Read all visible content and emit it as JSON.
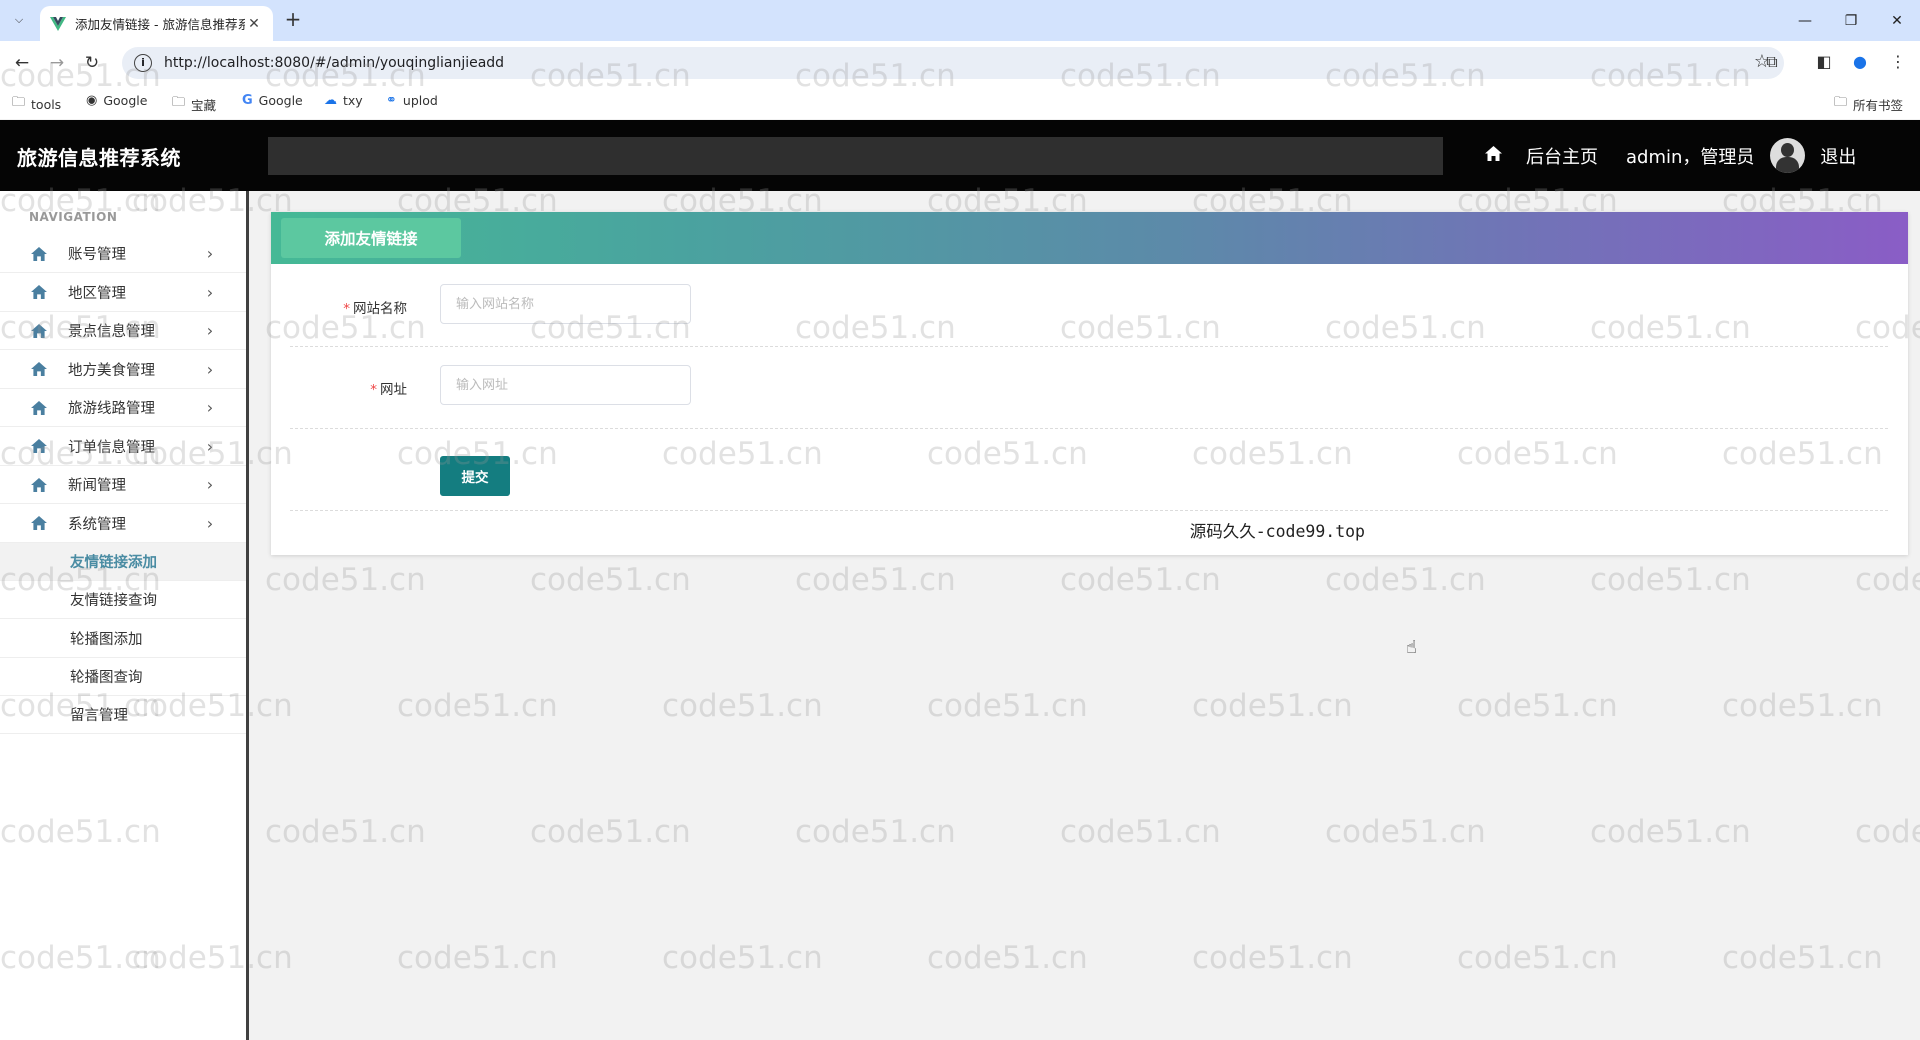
{
  "browser": {
    "tab_title": "添加友情链接 - 旅游信息推荐系",
    "url": "http://localhost:8080/#/admin/youqinglianjieadd",
    "bookmarks": [
      "tools",
      "Google",
      "宝藏",
      "Google",
      "txy",
      "uplod"
    ],
    "all_bookmarks": "所有书签"
  },
  "header": {
    "brand": "旅游信息推荐系统",
    "home_link": "后台主页",
    "user": "admin，管理员",
    "logout": "退出"
  },
  "sidebar": {
    "nav_title": "NAVIGATION",
    "items": [
      {
        "label": "账号管理"
      },
      {
        "label": "地区管理"
      },
      {
        "label": "景点信息管理"
      },
      {
        "label": "地方美食管理"
      },
      {
        "label": "旅游线路管理"
      },
      {
        "label": "订单信息管理"
      },
      {
        "label": "新闻管理"
      },
      {
        "label": "系统管理"
      }
    ],
    "sub_items": [
      {
        "label": "友情链接添加",
        "active": true
      },
      {
        "label": "友情链接查询",
        "active": false
      },
      {
        "label": "轮播图添加",
        "active": false
      },
      {
        "label": "轮播图查询",
        "active": false
      },
      {
        "label": "留言管理",
        "active": false
      }
    ]
  },
  "form": {
    "title": "添加友情链接",
    "fields": [
      {
        "label": "网站名称",
        "placeholder": "输入网站名称",
        "value": "",
        "required": true
      },
      {
        "label": "网址",
        "placeholder": "输入网址",
        "value": "",
        "required": true
      }
    ],
    "submit_label": "提交",
    "footer": "源码久久-code99.top"
  },
  "watermark": "code51.cn",
  "colors": {
    "header_bg": "#050505",
    "submit_bg": "#147d80",
    "active_sub": "#4a8ca3",
    "gradient_start": "#45b996",
    "gradient_end": "#8a5dc6"
  }
}
